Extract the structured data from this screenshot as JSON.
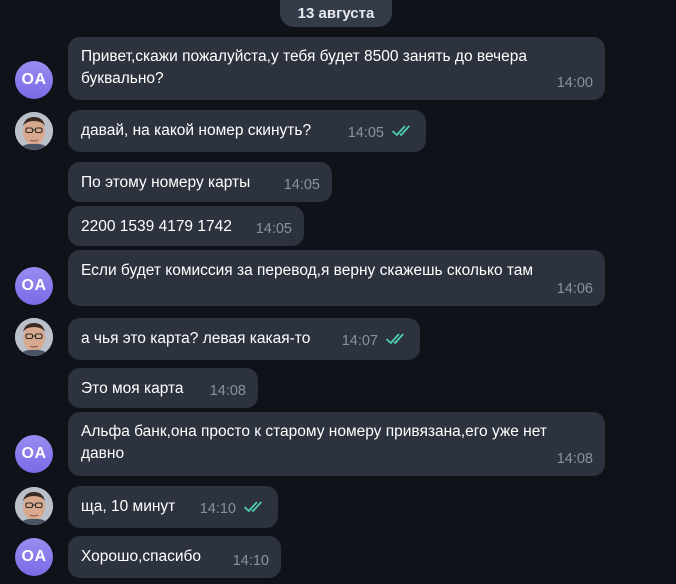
{
  "chat": {
    "date": "13 августа",
    "contact_initials": "OA",
    "messages": [
      {
        "line1": "Привет,скажи пожалуйста,у тебя будет 8500 занять до вечера",
        "line2": "буквально?",
        "time": "14:00"
      },
      {
        "text": "давай, на какой номер скинуть?",
        "time": "14:05",
        "status": "read"
      },
      {
        "text": "По этому номеру карты",
        "time": "14:05"
      },
      {
        "text": "2200 1539 4179 1742",
        "time": "14:05"
      },
      {
        "text": "Если будет комиссия за перевод,я верну скажешь сколько там",
        "time": "14:06"
      },
      {
        "text": "а чья это карта? левая какая-то",
        "time": "14:07",
        "status": "read"
      },
      {
        "text": "Это моя карта",
        "time": "14:08"
      },
      {
        "line1": "Альфа банк,она просто к старому номеру привязана,его уже нет",
        "line2": "давно",
        "time": "14:08"
      },
      {
        "text": "ща, 10 минут",
        "time": "14:10",
        "status": "read"
      },
      {
        "text": "Хорошо,спасибо",
        "time": "14:10"
      }
    ]
  },
  "colors": {
    "background": "#0f1218",
    "bubble": "#2d333e",
    "timestamp": "#8b929c",
    "read_check": "#4fd1b5",
    "avatar_gradient": "#8b7cf0"
  },
  "icons": {
    "read_receipt": "double-check-icon",
    "user_avatar": "user-photo-avatar"
  }
}
